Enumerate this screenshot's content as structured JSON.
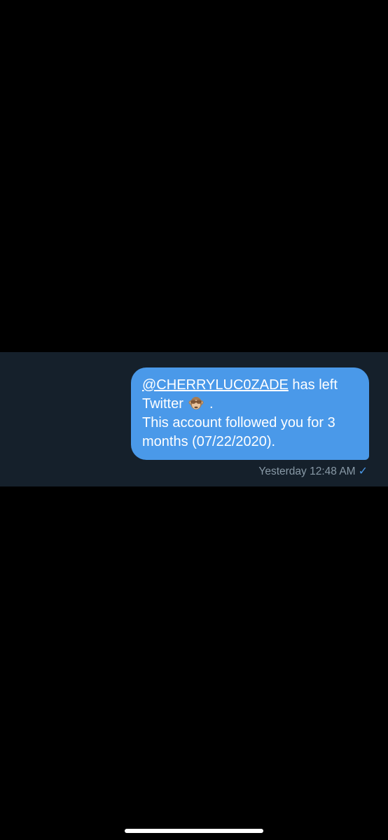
{
  "message": {
    "mention": "@CHERRYLUC0ZADE",
    "after_mention": " has left",
    "line2_text": "Twitter",
    "line2_punct": " .",
    "line3": "This account followed you for 3",
    "line4": "months (07/22/2020).",
    "emoji": "see-no-evil-monkey",
    "bubble_color": "#4a99e9"
  },
  "meta": {
    "timestamp": "Yesterday 12:48 AM",
    "status_icon": "checkmark"
  },
  "colors": {
    "background": "#000000",
    "dm_strip": "#15202b",
    "meta_text": "#8899a6"
  }
}
